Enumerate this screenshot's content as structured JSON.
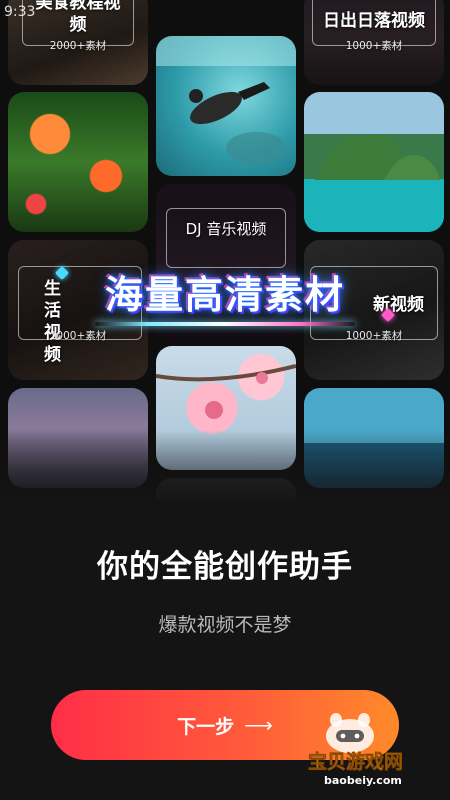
{
  "status": {
    "time": "9:33"
  },
  "collage": {
    "tiles": [
      {
        "title": "美食教程视频",
        "count": "2000+素材"
      },
      {
        "title": "日出日落视频",
        "count": "1000+素材"
      },
      {
        "title": "DJ 音乐视频"
      },
      {
        "title": "生活视频",
        "count": "1000+素材"
      },
      {
        "title": "新视频",
        "count": "1000+素材"
      }
    ],
    "banner": "海量高清素材"
  },
  "headline": "你的全能创作助手",
  "subhead": "爆款视频不是梦",
  "next_button": {
    "label": "下一步",
    "arrow": "⟶"
  },
  "watermark": {
    "title": "宝贝游戏网",
    "url": "baobeiy.com"
  },
  "colors": {
    "background": "#141414",
    "button_start": "#ff2e47",
    "button_end": "#ff8a2a",
    "subtext": "#b9b9b9"
  }
}
